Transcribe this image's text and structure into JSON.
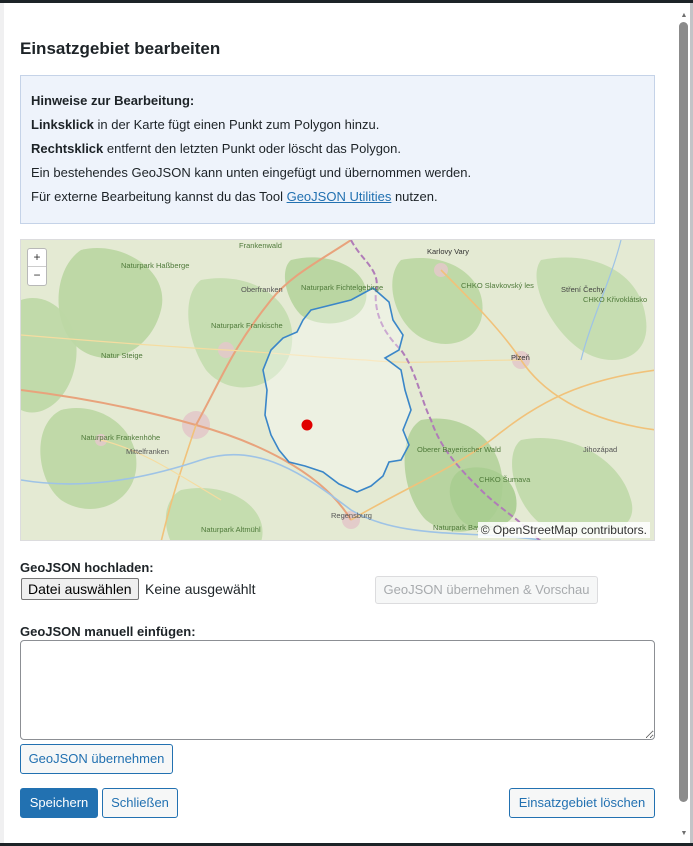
{
  "dialog": {
    "title": "Einsatzgebiet bearbeiten"
  },
  "notice": {
    "heading": "Hinweise zur Bearbeitung:",
    "line1_bold": "Linksklick",
    "line1_rest": " in der Karte fügt einen Punkt zum Polygon hinzu.",
    "line2_bold": "Rechtsklick",
    "line2_rest": " entfernt den letzten Punkt oder löscht das Polygon.",
    "line3": "Ein bestehendes GeoJSON kann unten eingefügt und übernommen werden.",
    "line4_pre": "Für externe Bearbeitung kannst du das Tool ",
    "line4_link": "GeoJSON Utilities",
    "line4_post": " nutzen."
  },
  "map": {
    "zoom_in": "+",
    "zoom_out": "−",
    "attribution": "© OpenStreetMap contributors.",
    "labels": [
      "Frankenwald",
      "Karlovy Vary",
      "Naturpark Haßberge",
      "Oberfranken",
      "Naturpark Fichtelgebirge",
      "CHKO Slavkovský les",
      "Stření Čechy",
      "CHKO Křivoklátsko",
      "Naturpark Frankische",
      "Natur Steige",
      "Mittelfranken",
      "Naturpark Frankenhöhe",
      "Plzeň",
      "Jihozápad",
      "CHKO Šumava",
      "Oberer Bayerischer Wald",
      "Naturpark Bayerischer",
      "Naturpark Altmühl",
      "Regensburg"
    ],
    "polygon_color": "#3a86c8",
    "marker_color": "#e00000"
  },
  "upload": {
    "label": "GeoJSON hochladen:",
    "file_button": "Datei auswählen",
    "file_status": "Keine ausgewählt",
    "apply_preview_button": "GeoJSON übernehmen & Vorschau"
  },
  "manual": {
    "label": "GeoJSON manuell einfügen:",
    "value": "",
    "apply_button": "GeoJSON übernehmen"
  },
  "footer": {
    "save_button": "Speichern",
    "close_button": "Schließen",
    "delete_button": "Einsatzgebiet löschen"
  }
}
